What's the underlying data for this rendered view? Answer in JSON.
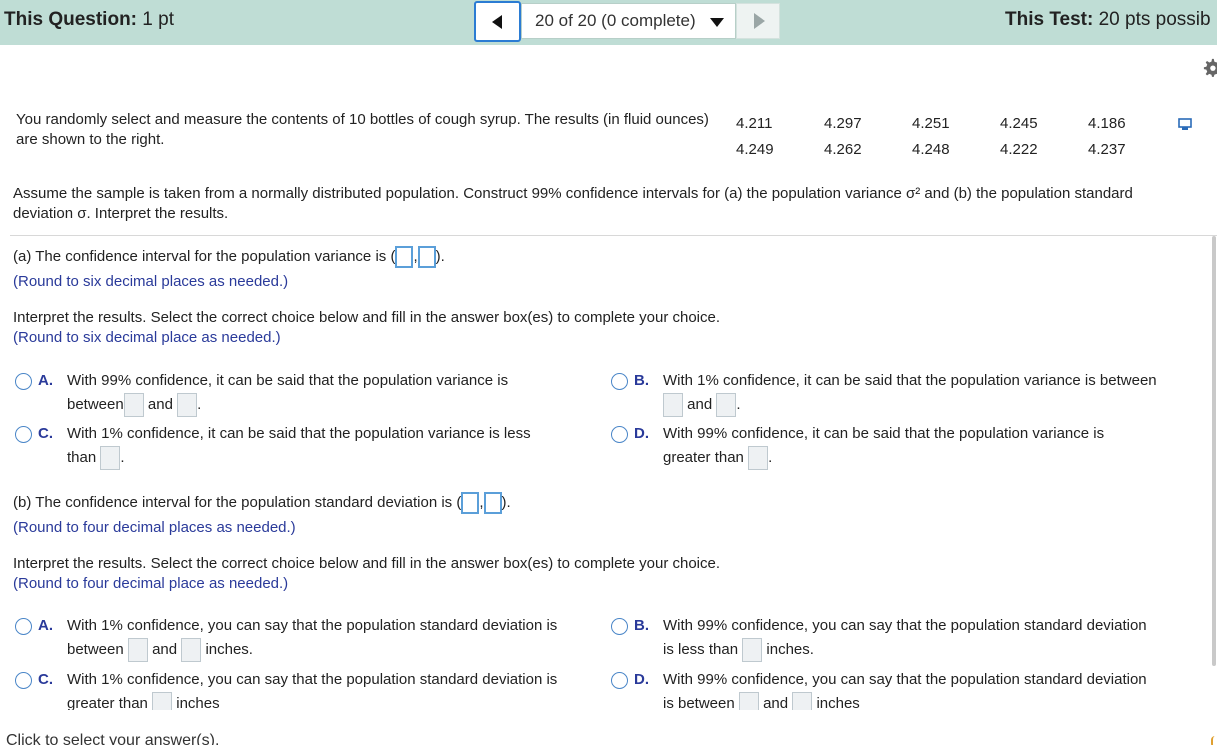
{
  "header": {
    "question_label": "This Question:",
    "question_value": "1 pt",
    "nav_position": "20 of 20 (0 complete)",
    "test_label": "This Test:",
    "test_value": "20 pts possib"
  },
  "problem": {
    "intro": "You randomly select and measure the contents of 10 bottles of cough syrup. The results (in fluid ounces) are shown to the right.",
    "data_row1": [
      "4.211",
      "4.297",
      "4.251",
      "4.245",
      "4.186"
    ],
    "data_row2": [
      "4.249",
      "4.262",
      "4.248",
      "4.222",
      "4.237"
    ],
    "assume": "Assume the sample is taken from a normally distributed population. Construct 99% confidence intervals for (a) the population variance σ² and (b) the population standard deviation σ. Interpret the results."
  },
  "part_a": {
    "prompt": "(a) The confidence interval for the population variance is (",
    "comma": ",",
    "close": ").",
    "round": "(Round to six decimal places as needed.)",
    "interpret": "Interpret the results. Select the correct choice below and fill in the answer box(es) to complete your choice.",
    "interpret_round": "(Round to six decimal place as needed.)",
    "options": [
      {
        "letter": "A.",
        "line1": "With 99% confidence, it can be said that  the population variance is",
        "line2_pre": "between",
        "line2_mid": "and",
        "line2_post": "."
      },
      {
        "letter": "B.",
        "line1": "With 1% confidence, it can be said that the population variance is between",
        "line2_mid": "and",
        "line2_post": "."
      },
      {
        "letter": "C.",
        "line1": "With 1% confidence, it can be said that the population variance is less",
        "line2_pre": "than",
        "line2_post": "."
      },
      {
        "letter": "D.",
        "line1": "With 99% confidence, it can be said that the population variance is",
        "line2_pre": "greater than",
        "line2_post": "."
      }
    ]
  },
  "part_b": {
    "prompt": "(b) The confidence interval for the population standard deviation is (",
    "comma": ",",
    "close": ").",
    "round": "(Round to four decimal places as needed.)",
    "interpret": "Interpret the results. Select the correct choice below and fill in the answer box(es) to complete your choice.",
    "interpret_round": "(Round to four decimal place as needed.)",
    "options": [
      {
        "letter": "A.",
        "line1": "With 1% confidence, you can say that the population standard deviation is",
        "line2_pre": "between",
        "line2_mid": "and",
        "line2_post": "inches."
      },
      {
        "letter": "B.",
        "line1": "With 99% confidence, you can say that the population standard deviation",
        "line2_pre": "is less than",
        "line2_post": "inches."
      },
      {
        "letter": "C.",
        "line1": "With 1% confidence, you can say that the population standard deviation is",
        "line2_pre": "greater than",
        "line2_post": "inches"
      },
      {
        "letter": "D.",
        "line1": "With 99% confidence, you can say that the population standard deviation",
        "line2_pre": "is between",
        "line2_mid": "and",
        "line2_post": "inches"
      }
    ]
  },
  "footer": {
    "text": "Click to select your answer(s)."
  },
  "colors": {
    "header_bg": "#bfddd5",
    "accent_blue": "#2a3a9a",
    "radio_blue": "#4a86c8"
  }
}
